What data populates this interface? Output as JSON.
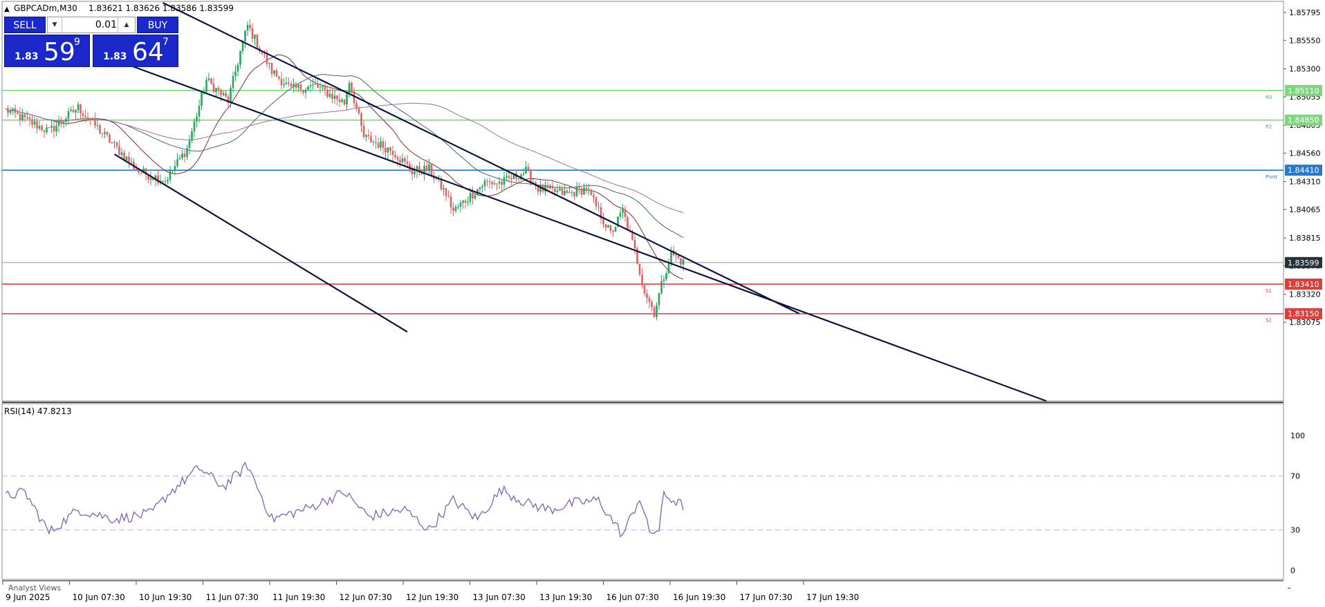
{
  "header": {
    "collapse_arrow": "▲",
    "title": "GBPCADm,M30",
    "ohlc": "1.83621 1.83626 1.83586 1.83599"
  },
  "trade_panel": {
    "sell_label": "SELL",
    "buy_label": "BUY",
    "lot_value": "0.01",
    "bid": {
      "small": "1.83",
      "big": "59",
      "sup": "9"
    },
    "ask": {
      "small": "1.83",
      "big": "64",
      "sup": "7"
    }
  },
  "price_axis": {
    "ticks": [
      {
        "label": "1.85795",
        "value": 1.85795
      },
      {
        "label": "1.85550",
        "value": 1.8555
      },
      {
        "label": "1.85300",
        "value": 1.853
      },
      {
        "label": "1.85055",
        "value": 1.85055
      },
      {
        "label": "1.84805",
        "value": 1.84805
      },
      {
        "label": "1.84560",
        "value": 1.8456
      },
      {
        "label": "1.84310",
        "value": 1.8431
      },
      {
        "label": "1.84065",
        "value": 1.84065
      },
      {
        "label": "1.83815",
        "value": 1.83815
      },
      {
        "label": "1.83570",
        "value": 1.8357
      },
      {
        "label": "1.83320",
        "value": 1.8332
      },
      {
        "label": "1.83075",
        "value": 1.83075
      }
    ]
  },
  "levels": [
    {
      "name": "R3",
      "label": "1.85110",
      "value": 1.8511,
      "color": "#7fd67f",
      "tag": "R3",
      "tag_color": "#4caf50"
    },
    {
      "name": "R2",
      "label": "1.84850",
      "value": 1.8485,
      "color": "#7fd67f",
      "tag": "R2",
      "tag_color": "#4caf50"
    },
    {
      "name": "Pivot",
      "label": "1.84410",
      "value": 1.8441,
      "color": "#2a78c8",
      "tag": "Pivot",
      "tag_color": "#2a78c8"
    },
    {
      "name": "current",
      "label": "1.83599",
      "value": 1.83599,
      "color": "#9a9a9a",
      "tag": "",
      "tag_color": "#263238"
    },
    {
      "name": "S1",
      "label": "1.83410",
      "value": 1.8341,
      "color": "#d9403a",
      "tag": "S1",
      "tag_color": "#d9403a"
    },
    {
      "name": "S2",
      "label": "1.83150",
      "value": 1.8315,
      "color": "#d9403a",
      "tag": "S2",
      "tag_color": "#d9403a"
    }
  ],
  "rsi": {
    "label": "RSI(14) 47.8213",
    "ticks": [
      {
        "label": "100",
        "value": 100
      },
      {
        "label": "70",
        "value": 70
      },
      {
        "label": "30",
        "value": 30
      },
      {
        "label": "0",
        "value": 0
      }
    ],
    "color": "#7a63b8"
  },
  "time_axis": [
    "9 Jun 2025",
    "10 Jun 07:30",
    "10 Jun 19:30",
    "11 Jun 07:30",
    "11 Jun 19:30",
    "12 Jun 07:30",
    "12 Jun 19:30",
    "13 Jun 07:30",
    "13 Jun 19:30",
    "16 Jun 07:30",
    "16 Jun 19:30",
    "17 Jun 07:30",
    "17 Jun 19:30"
  ],
  "bottom_label": "Analyst Views",
  "colors": {
    "bull": "#26a65b",
    "bear": "#e06060",
    "channel": "#0b1440",
    "ma_fast": "#7a2e2e",
    "ma_mid": "#3d6b5a",
    "ma_slow": "#9a6fa0"
  },
  "chart_data": {
    "type": "candlestick",
    "symbol": "GBPCADm",
    "timeframe": "M30",
    "candle_count": 280,
    "price_range": [
      1.8299,
      1.8585
    ],
    "anchors": [
      {
        "bar": 0,
        "price": 1.8494
      },
      {
        "bar": 18,
        "price": 1.8475
      },
      {
        "bar": 30,
        "price": 1.8496
      },
      {
        "bar": 55,
        "price": 1.844
      },
      {
        "bar": 66,
        "price": 1.8432
      },
      {
        "bar": 75,
        "price": 1.846
      },
      {
        "bar": 83,
        "price": 1.852
      },
      {
        "bar": 92,
        "price": 1.8502
      },
      {
        "bar": 97,
        "price": 1.8545
      },
      {
        "bar": 100,
        "price": 1.8568
      },
      {
        "bar": 110,
        "price": 1.8528
      },
      {
        "bar": 118,
        "price": 1.8512
      },
      {
        "bar": 128,
        "price": 1.8515
      },
      {
        "bar": 140,
        "price": 1.85
      },
      {
        "bar": 142,
        "price": 1.852
      },
      {
        "bar": 148,
        "price": 1.847
      },
      {
        "bar": 160,
        "price": 1.8458
      },
      {
        "bar": 168,
        "price": 1.844
      },
      {
        "bar": 175,
        "price": 1.8442
      },
      {
        "bar": 182,
        "price": 1.842
      },
      {
        "bar": 185,
        "price": 1.8405
      },
      {
        "bar": 198,
        "price": 1.843
      },
      {
        "bar": 205,
        "price": 1.843
      },
      {
        "bar": 215,
        "price": 1.844
      },
      {
        "bar": 220,
        "price": 1.8425
      },
      {
        "bar": 232,
        "price": 1.842
      },
      {
        "bar": 240,
        "price": 1.8425
      },
      {
        "bar": 250,
        "price": 1.8385
      },
      {
        "bar": 255,
        "price": 1.8405
      },
      {
        "bar": 260,
        "price": 1.837
      },
      {
        "bar": 264,
        "price": 1.8335
      },
      {
        "bar": 268,
        "price": 1.8316
      },
      {
        "bar": 272,
        "price": 1.8348
      },
      {
        "bar": 275,
        "price": 1.8368
      },
      {
        "bar": 280,
        "price": 1.836
      }
    ],
    "rsi_anchors": [
      {
        "bar": 0,
        "value": 55
      },
      {
        "bar": 8,
        "value": 58
      },
      {
        "bar": 18,
        "value": 28
      },
      {
        "bar": 30,
        "value": 45
      },
      {
        "bar": 45,
        "value": 38
      },
      {
        "bar": 60,
        "value": 42
      },
      {
        "bar": 68,
        "value": 58
      },
      {
        "bar": 80,
        "value": 76
      },
      {
        "bar": 90,
        "value": 62
      },
      {
        "bar": 100,
        "value": 78
      },
      {
        "bar": 110,
        "value": 38
      },
      {
        "bar": 125,
        "value": 46
      },
      {
        "bar": 140,
        "value": 58
      },
      {
        "bar": 150,
        "value": 40
      },
      {
        "bar": 165,
        "value": 45
      },
      {
        "bar": 175,
        "value": 30
      },
      {
        "bar": 185,
        "value": 52
      },
      {
        "bar": 195,
        "value": 38
      },
      {
        "bar": 205,
        "value": 60
      },
      {
        "bar": 215,
        "value": 50
      },
      {
        "bar": 225,
        "value": 45
      },
      {
        "bar": 235,
        "value": 50
      },
      {
        "bar": 245,
        "value": 52
      },
      {
        "bar": 255,
        "value": 26
      },
      {
        "bar": 262,
        "value": 54
      },
      {
        "bar": 266,
        "value": 28
      },
      {
        "bar": 270,
        "value": 30
      },
      {
        "bar": 272,
        "value": 56
      },
      {
        "bar": 276,
        "value": 52
      },
      {
        "bar": 280,
        "value": 47.8
      }
    ],
    "channels": [
      {
        "name": "channel-upper",
        "p1": {
          "bar": 65,
          "price": 1.8588
        },
        "p2": {
          "bar": 328,
          "price": 1.8315
        }
      },
      {
        "name": "channel-middle",
        "p1": {
          "bar": 45,
          "price": 1.8538
        },
        "p2": {
          "bar": 275,
          "price": 1.8359
        }
      },
      {
        "name": "channel-lower",
        "p1": {
          "bar": 45,
          "price": 1.8455
        },
        "p2": {
          "bar": 166,
          "price": 1.8299
        }
      }
    ]
  }
}
